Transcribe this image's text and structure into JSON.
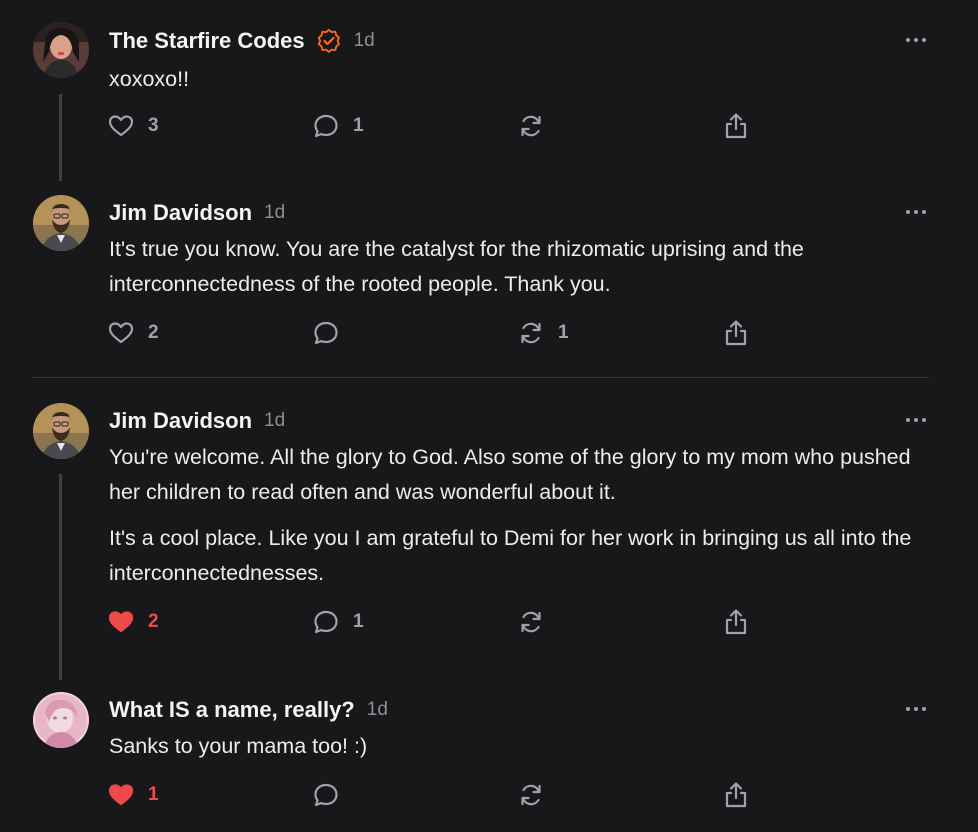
{
  "comments": [
    {
      "author": "The Starfire Codes",
      "verified": true,
      "time": "1d",
      "paragraphs": [
        "xoxoxo!!"
      ],
      "likes": "3",
      "liked": false,
      "replies": "1",
      "restacks": "",
      "avatar_icon": "woman-portrait"
    },
    {
      "author": "Jim Davidson",
      "verified": false,
      "time": "1d",
      "paragraphs": [
        "It's true you know. You are the catalyst for the rhizomatic uprising and the interconnectedness of the rooted people. Thank you."
      ],
      "likes": "2",
      "liked": false,
      "replies": "",
      "restacks": "1",
      "avatar_icon": "bearded-man-portrait"
    },
    {
      "author": "Jim Davidson",
      "verified": false,
      "time": "1d",
      "paragraphs": [
        "You're welcome. All the glory to God. Also some of the glory to my mom who pushed her children to read often and was wonderful about it.",
        "It's a cool place. Like you I am grateful to Demi for her work in bringing us all into the interconnectednesses."
      ],
      "likes": "2",
      "liked": true,
      "replies": "1",
      "restacks": "",
      "avatar_icon": "bearded-man-portrait"
    },
    {
      "author": "What IS a name, really?",
      "verified": false,
      "time": "1d",
      "paragraphs": [
        "Sanks to your mama too! :)"
      ],
      "likes": "1",
      "liked": true,
      "replies": "",
      "restacks": "",
      "avatar_icon": "pink-portrait"
    }
  ],
  "colors": {
    "background": "#18181b",
    "liked": "#ef4a4a",
    "verified_badge": "#ff6719",
    "muted": "#a1a1aa"
  }
}
